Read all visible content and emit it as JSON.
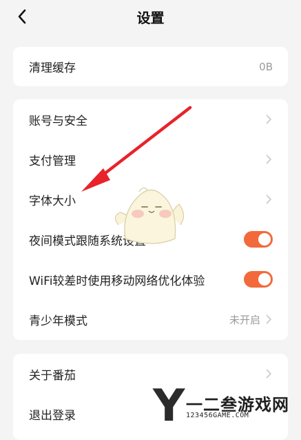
{
  "header": {
    "title": "设置",
    "back_icon": "chevron-left-icon"
  },
  "cache": {
    "label": "清理缓存",
    "value": "0B"
  },
  "account_group": {
    "account_security": "账号与安全",
    "payment": "支付管理",
    "font_size": "字体大小",
    "night_mode_follow_system": {
      "label": "夜间模式跟随系统设置",
      "on": true
    },
    "wifi_optimize": {
      "label": "WiFi较差时使用移动网络优化体验",
      "on": true
    },
    "teen_mode": {
      "label": "青少年模式",
      "value": "未开启"
    }
  },
  "about_group": {
    "about": "关于番茄",
    "logout": "退出登录"
  },
  "watermark": {
    "letter": "Y",
    "name": "一二叁游戏网",
    "url": "123456GAME.COM"
  },
  "colors": {
    "accent": "#f26a3b",
    "arrow": "#e8232a",
    "background": "#f4f4f4"
  }
}
